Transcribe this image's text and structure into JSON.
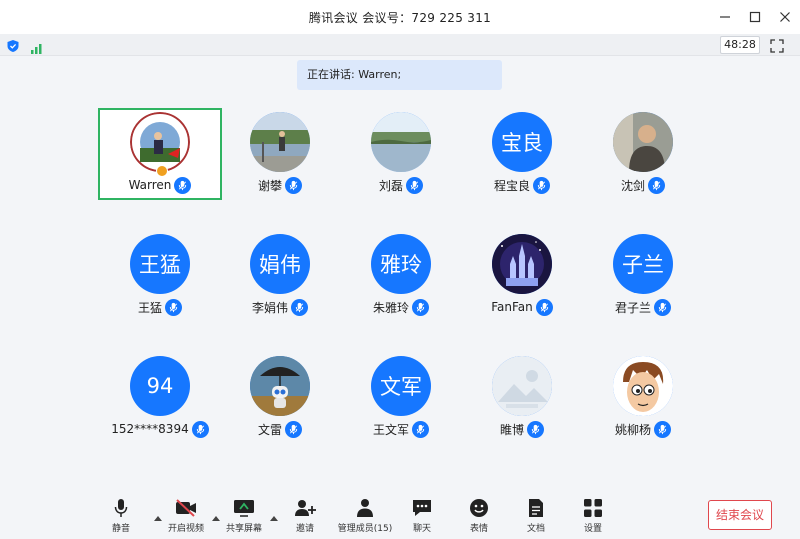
{
  "window": {
    "title": "腾讯会议  会议号：729 225 311"
  },
  "statusbar": {
    "timer": "48:28"
  },
  "speaking_banner": "正在讲话: Warren;",
  "participants": [
    {
      "name": "Warren",
      "initials": "",
      "avatar": "photo-badge",
      "active": true
    },
    {
      "name": "谢攀",
      "initials": "",
      "avatar": "photo-lake-person"
    },
    {
      "name": "刘磊",
      "initials": "",
      "avatar": "photo-lake"
    },
    {
      "name": "程宝良",
      "initials": "宝良",
      "avatar": "text"
    },
    {
      "name": "沈剑",
      "initials": "",
      "avatar": "photo-man"
    },
    {
      "name": "王猛",
      "initials": "王猛",
      "avatar": "text"
    },
    {
      "name": "李娟伟",
      "initials": "娟伟",
      "avatar": "text"
    },
    {
      "name": "朱雅玲",
      "initials": "雅玲",
      "avatar": "text"
    },
    {
      "name": "FanFan",
      "initials": "",
      "avatar": "photo-castle"
    },
    {
      "name": "君子兰",
      "initials": "子兰",
      "avatar": "text"
    },
    {
      "name": "152****8394",
      "initials": "94",
      "avatar": "text"
    },
    {
      "name": "文雷",
      "initials": "",
      "avatar": "photo-robot"
    },
    {
      "name": "王文军",
      "initials": "文军",
      "avatar": "text"
    },
    {
      "name": "睢博",
      "initials": "",
      "avatar": "photo-placeholder"
    },
    {
      "name": "姚柳杨",
      "initials": "",
      "avatar": "photo-cartoon"
    }
  ],
  "toolbar": {
    "mute": "静音",
    "video": "开启视频",
    "share": "共享屏幕",
    "invite": "邀请",
    "members": "管理成员(15)",
    "chat": "聊天",
    "reaction": "表情",
    "docs": "文档",
    "settings": "设置",
    "end": "结束会议"
  },
  "colors": {
    "accent": "#1677ff",
    "active_border": "#2fb462",
    "end_red": "#e0474d",
    "banner": "#dce8fb"
  }
}
